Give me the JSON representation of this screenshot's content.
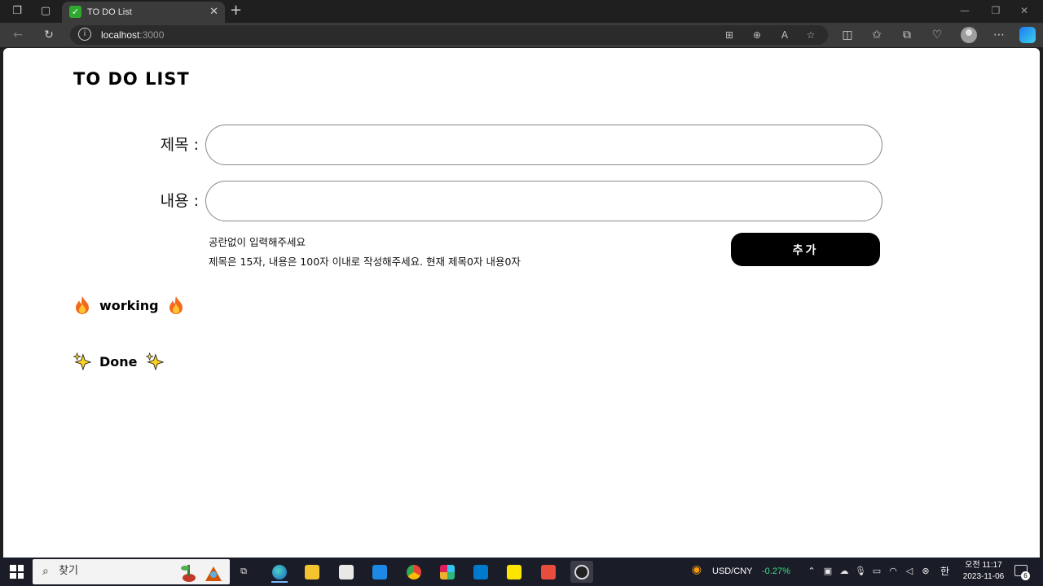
{
  "browser": {
    "tab_title": "TO DO List",
    "address_host": "localhost",
    "address_port": ":3000"
  },
  "page": {
    "title": "TO DO LIST",
    "form": {
      "title_label": "제목 :",
      "title_value": "",
      "content_label": "내용 :",
      "content_value": "",
      "hint_line1": "공란없이 입력해주세요",
      "hint_line2": "제목은 15자, 내용은 100자 이내로 작성해주세요. 현재 제목0자 내용0자",
      "add_button": "추가"
    },
    "sections": {
      "working": "working",
      "done": "Done"
    }
  },
  "taskbar": {
    "search_placeholder": "찾기",
    "ticker_name": "USD/CNY",
    "ticker_change": "-0.27%",
    "ticker_change_color": "#3ddc84",
    "ime": "한",
    "time": "오전 11:17",
    "date": "2023-11-06",
    "notifications": "6"
  }
}
